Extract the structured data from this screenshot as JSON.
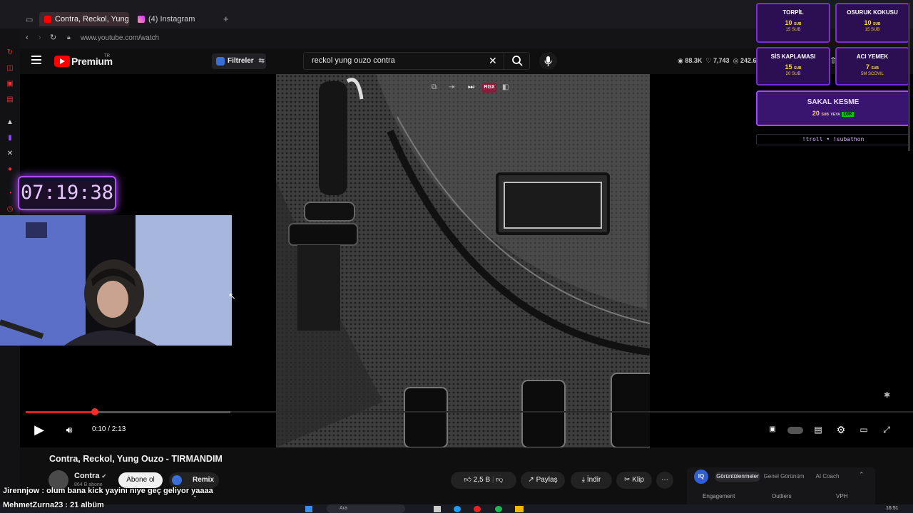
{
  "browser": {
    "tabs": [
      {
        "label": "Contra, Reckol, Yung",
        "active": true
      },
      {
        "label": "(4) Instagram",
        "active": false
      }
    ],
    "url": "www.youtube.com/watch",
    "new_tab": "+"
  },
  "youtube": {
    "logo_text": "Premium",
    "logo_badge": "TR",
    "filters_label": "Filtreler",
    "search_query": "reckol yung ouzo contra",
    "stats": [
      "88.3K",
      "7,743",
      "242.6"
    ],
    "video": {
      "title": "Contra, Reckol, Yung Ouzo - TIRMANDIM",
      "time_current": "0:10",
      "time_total": "2:13",
      "time_display": "0:10 / 2:13",
      "progress": 0.075,
      "rgx_label": "RGX"
    },
    "channel": {
      "name": "Contra",
      "subscribers": "864 B abone",
      "subscribe_label": "Abone ol",
      "remix_label": "Remix"
    },
    "actions": {
      "likes": "2,5 B",
      "share": "Paylaş",
      "download": "İndir",
      "clip": "Klip",
      "more": "···"
    },
    "iq_panel": {
      "badge": "IQ",
      "tabs": [
        "Görüntülenmeler",
        "Genel Görünüm",
        "AI Coach"
      ],
      "headers": [
        "Engagement",
        "Outliers",
        "VPH"
      ]
    }
  },
  "stream_overlay": {
    "timer": "07:19:38",
    "cards": [
      {
        "title": "TORPİL",
        "price": "10",
        "unit": "SUB",
        "sub": "15 SUB"
      },
      {
        "title": "OSURUK KOKUSU",
        "price": "10",
        "unit": "SUB",
        "sub": "15 SUB"
      },
      {
        "title": "SİS KAPLAMASI",
        "price": "15",
        "unit": "SUB",
        "sub": "20 SUB"
      },
      {
        "title": "ACI YEMEK",
        "price": "7",
        "unit": "SUB",
        "sub": "5M SCOVIL"
      },
      {
        "title": "SAKAL KESME",
        "price": "20",
        "unit": "SUB",
        "sub_or": "VEYA",
        "sub_alt": "10K"
      }
    ],
    "commands": "!troll  •  !subathon",
    "chat": [
      {
        "user": "Jirennjow",
        "message": "olum bana kick yayini niye geç geliyor yaaaa"
      },
      {
        "user": "MehmetZurna23",
        "message": "21 albüm"
      }
    ]
  },
  "colors": {
    "accent_red": "#ff0000",
    "overlay_purple": "#7b2cd6",
    "timer_glow": "#b44cff"
  },
  "taskbar": {
    "time": "16:51",
    "search": "Ara"
  }
}
